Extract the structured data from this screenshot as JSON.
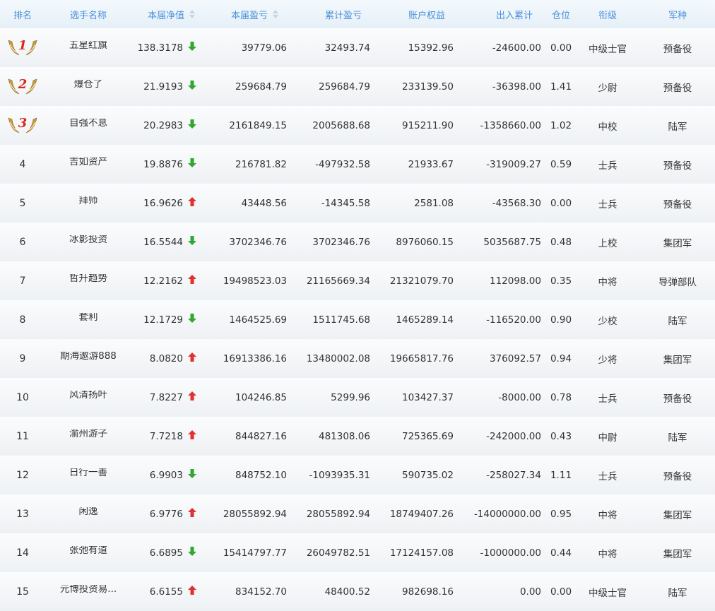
{
  "headers": {
    "rank": "排名",
    "name": "选手名称",
    "nav": "本届净值",
    "pnl": "本届盈亏",
    "cum_pnl": "累计盈亏",
    "equity": "账户权益",
    "flow": "出入累计",
    "position": "仓位",
    "grade": "衔级",
    "arm": "军种"
  },
  "colors": {
    "up": "#e03030",
    "down": "#2fa82f",
    "header_text": "#4a90d9",
    "medal_wing": "#c89a3a",
    "medal_num": "#d52b1e"
  },
  "rows": [
    {
      "rank": "1",
      "medal": true,
      "name": "五星红旗",
      "nav": "138.3178",
      "trend": "down",
      "pnl": "39779.06",
      "cum_pnl": "32493.74",
      "equity": "15392.96",
      "flow": "-24600.00",
      "position": "0.00",
      "grade": "中级士官",
      "arm": "预备役"
    },
    {
      "rank": "2",
      "medal": true,
      "name": "爆仓了",
      "nav": "21.9193",
      "trend": "down",
      "pnl": "259684.79",
      "cum_pnl": "259684.79",
      "equity": "233139.50",
      "flow": "-36398.00",
      "position": "1.41",
      "grade": "少尉",
      "arm": "预备役"
    },
    {
      "rank": "3",
      "medal": true,
      "name": "自强不息",
      "nav": "20.2983",
      "trend": "down",
      "pnl": "2161849.15",
      "cum_pnl": "2005688.68",
      "equity": "915211.90",
      "flow": "-1358660.00",
      "position": "1.02",
      "grade": "中校",
      "arm": "陆军"
    },
    {
      "rank": "4",
      "medal": false,
      "name": "吉如资产",
      "nav": "19.8876",
      "trend": "down",
      "pnl": "216781.82",
      "cum_pnl": "-497932.58",
      "equity": "21933.67",
      "flow": "-319009.27",
      "position": "0.59",
      "grade": "士兵",
      "arm": "预备役"
    },
    {
      "rank": "5",
      "medal": false,
      "name": "拜师",
      "nav": "16.9626",
      "trend": "up",
      "pnl": "43448.56",
      "cum_pnl": "-14345.58",
      "equity": "2581.08",
      "flow": "-43568.30",
      "position": "0.00",
      "grade": "士兵",
      "arm": "预备役"
    },
    {
      "rank": "6",
      "medal": false,
      "name": "冰影投资",
      "nav": "16.5544",
      "trend": "down",
      "pnl": "3702346.76",
      "cum_pnl": "3702346.76",
      "equity": "8976060.15",
      "flow": "5035687.75",
      "position": "0.48",
      "grade": "上校",
      "arm": "集团军"
    },
    {
      "rank": "7",
      "medal": false,
      "name": "哲升趋势",
      "nav": "12.2162",
      "trend": "up",
      "pnl": "19498523.03",
      "cum_pnl": "21165669.34",
      "equity": "21321079.70",
      "flow": "112098.00",
      "position": "0.35",
      "grade": "中将",
      "arm": "导弹部队"
    },
    {
      "rank": "8",
      "medal": false,
      "name": "套利",
      "nav": "12.1729",
      "trend": "down",
      "pnl": "1464525.69",
      "cum_pnl": "1511745.68",
      "equity": "1465289.14",
      "flow": "-116520.00",
      "position": "0.90",
      "grade": "少校",
      "arm": "陆军"
    },
    {
      "rank": "9",
      "medal": false,
      "name": "期海遨游888",
      "nav": "8.0820",
      "trend": "up",
      "pnl": "16913386.16",
      "cum_pnl": "13480002.08",
      "equity": "19665817.76",
      "flow": "376092.57",
      "position": "0.94",
      "grade": "少将",
      "arm": "集团军"
    },
    {
      "rank": "10",
      "medal": false,
      "name": "风清扬叶",
      "nav": "7.8227",
      "trend": "up",
      "pnl": "104246.85",
      "cum_pnl": "5299.96",
      "equity": "103427.37",
      "flow": "-8000.00",
      "position": "0.78",
      "grade": "士兵",
      "arm": "预备役"
    },
    {
      "rank": "11",
      "medal": false,
      "name": "渝州游子",
      "nav": "7.7218",
      "trend": "up",
      "pnl": "844827.16",
      "cum_pnl": "481308.06",
      "equity": "725365.69",
      "flow": "-242000.00",
      "position": "0.43",
      "grade": "中尉",
      "arm": "陆军"
    },
    {
      "rank": "12",
      "medal": false,
      "name": "日行一善",
      "nav": "6.9903",
      "trend": "down",
      "pnl": "848752.10",
      "cum_pnl": "-1093935.31",
      "equity": "590735.02",
      "flow": "-258027.34",
      "position": "1.11",
      "grade": "士兵",
      "arm": "预备役"
    },
    {
      "rank": "13",
      "medal": false,
      "name": "闲逸",
      "nav": "6.9776",
      "trend": "up",
      "pnl": "28055892.94",
      "cum_pnl": "28055892.94",
      "equity": "18749407.26",
      "flow": "-14000000.00",
      "position": "0.95",
      "grade": "中将",
      "arm": "集团军"
    },
    {
      "rank": "14",
      "medal": false,
      "name": "张弛有道",
      "nav": "6.6895",
      "trend": "down",
      "pnl": "15414797.77",
      "cum_pnl": "26049782.51",
      "equity": "17124157.08",
      "flow": "-1000000.00",
      "position": "0.44",
      "grade": "中将",
      "arm": "集团军"
    },
    {
      "rank": "15",
      "medal": false,
      "name": "元博投资易...",
      "nav": "6.6155",
      "trend": "up",
      "pnl": "834152.70",
      "cum_pnl": "48400.52",
      "equity": "982698.16",
      "flow": "0.00",
      "position": "0.00",
      "grade": "中级士官",
      "arm": "陆军"
    }
  ]
}
